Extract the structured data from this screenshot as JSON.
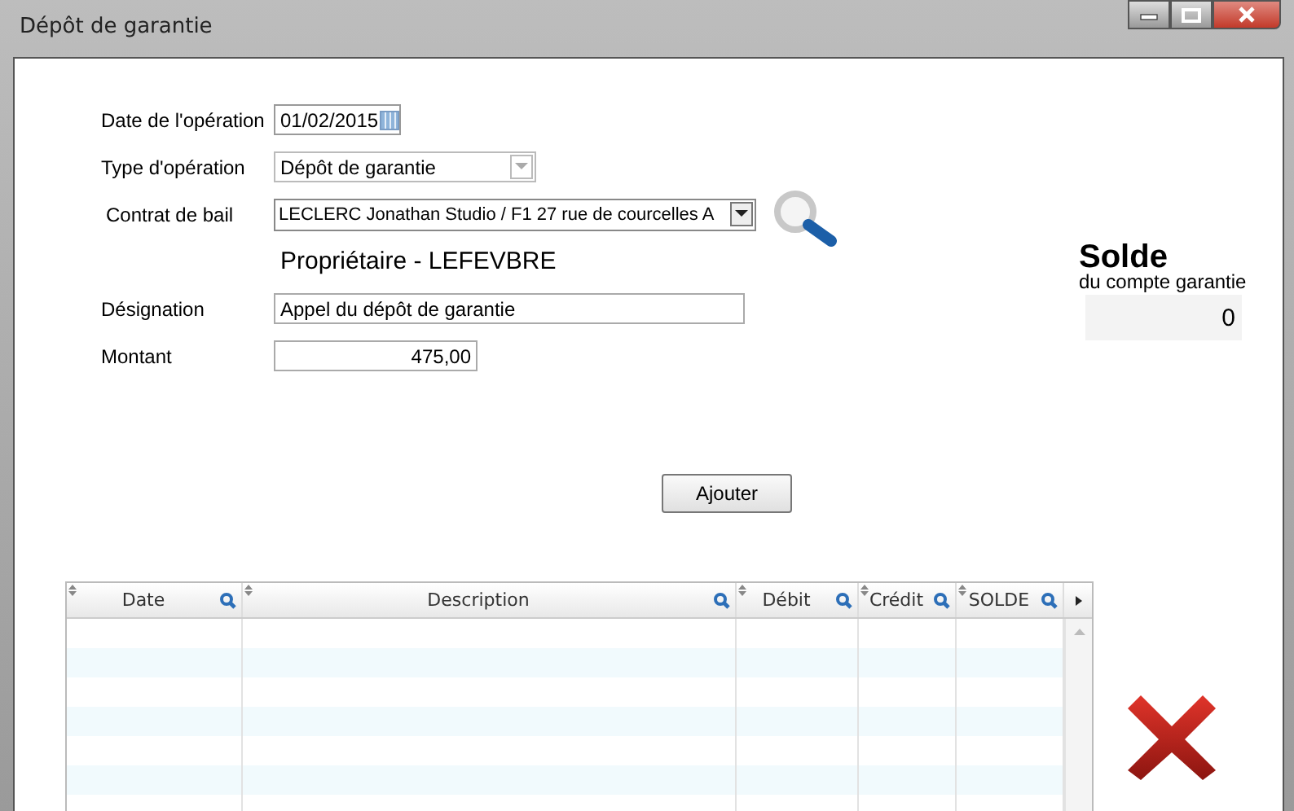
{
  "window": {
    "title": "Dépôt de garantie"
  },
  "form": [
    {
      "kind": "date",
      "label": "Date de l'opération",
      "value": "01/02/2015"
    },
    {
      "kind": "combo",
      "label": "Type d'opération",
      "value": "Dépôt de garantie"
    },
    {
      "kind": "lookup",
      "label": "Contrat de bail",
      "value": "LECLERC Jonathan Studio / F1 27 rue de courcelles A"
    },
    {
      "kind": "note",
      "text": "Propriétaire - LEFEVBRE"
    },
    {
      "kind": "text",
      "label": "Désignation",
      "value": "Appel du dépôt de garantie"
    },
    {
      "kind": "amount",
      "label": "Montant",
      "value": "475,00"
    }
  ],
  "balance": {
    "title": "Solde",
    "subtitle": "du compte garantie",
    "value": "0"
  },
  "add_button": "Ajouter",
  "table": {
    "columns": [
      "Date",
      "Description",
      "Débit",
      "Crédit",
      "SOLDE"
    ]
  }
}
